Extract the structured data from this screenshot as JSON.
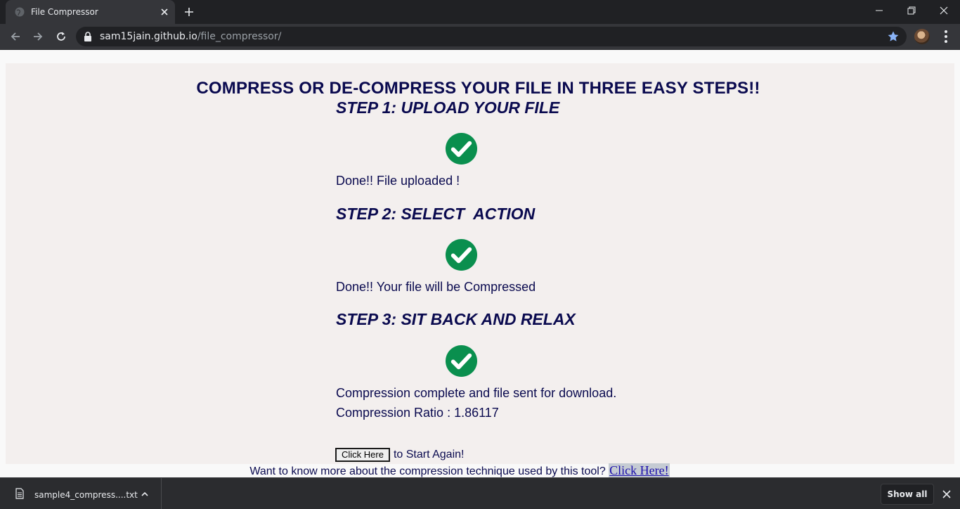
{
  "browser": {
    "tab_title": "File Compressor",
    "url_host": "sam15jain.github.io",
    "url_path": "/file_compressor/"
  },
  "page": {
    "title": "COMPRESS OR DE-COMPRESS YOUR FILE IN THREE EASY STEPS!!",
    "steps": [
      {
        "heading": "STEP 1: UPLOAD YOUR FILE",
        "status": "Done!! File uploaded !",
        "icon": "check-circle-icon"
      },
      {
        "heading": "STEP 2: SELECT  ACTION",
        "status": "Done!! Your file will be Compressed",
        "icon": "check-circle-icon"
      },
      {
        "heading": "STEP 3: SIT BACK AND RELAX",
        "status": "Compression complete and file sent for download.",
        "icon": "check-circle-icon"
      }
    ],
    "compression_ratio": "Compression Ratio : 1.86117",
    "restart_button": "Click Here",
    "restart_text": "to Start Again!",
    "info_text": "Want to know more about the compression technique used by this tool?",
    "info_link": "Click Here!",
    "accent_color": "#0a0a4f",
    "check_color": "#0a8f4e"
  },
  "downloads": {
    "file_name": "sample4_compress....txt",
    "show_all": "Show all"
  }
}
